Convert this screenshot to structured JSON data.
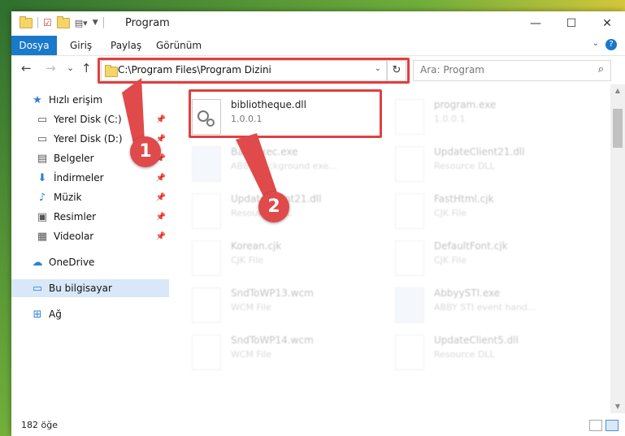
{
  "window": {
    "title": "Program",
    "minimize": "—",
    "maximize": "☐",
    "close": "✕"
  },
  "ribbon": {
    "tabs": [
      "Dosya",
      "Giriş",
      "Paylaş",
      "Görünüm"
    ]
  },
  "nav": {
    "back": "←",
    "forward": "→",
    "recent": "⌄",
    "up": "↑",
    "address": "C:\\Program Files\\Program Dizini",
    "refresh": "↻",
    "search_placeholder": "Ara: Program"
  },
  "sidebar": {
    "items": [
      {
        "label": "Hızlı erişim",
        "icon": "star-icon",
        "glyph": "★"
      },
      {
        "label": "Yerel Disk (C:)",
        "icon": "drive-icon",
        "glyph": "▭"
      },
      {
        "label": "Yerel Disk (D:)",
        "icon": "drive-icon",
        "glyph": "▭"
      },
      {
        "label": "Belgeler",
        "icon": "documents-icon",
        "glyph": "▤"
      },
      {
        "label": "İndirmeler",
        "icon": "download-icon",
        "glyph": "⬇"
      },
      {
        "label": "Müzik",
        "icon": "music-icon",
        "glyph": "♪"
      },
      {
        "label": "Resimler",
        "icon": "pictures-icon",
        "glyph": "▣"
      },
      {
        "label": "Videolar",
        "icon": "videos-icon",
        "glyph": "▦"
      },
      {
        "label": "OneDrive",
        "icon": "cloud-icon",
        "glyph": "☁"
      },
      {
        "label": "Bu bilgisayar",
        "icon": "computer-icon",
        "glyph": "▭"
      },
      {
        "label": "Ağ",
        "icon": "network-icon",
        "glyph": "⊞"
      }
    ]
  },
  "files": [
    {
      "name": "bibliotheque.dll",
      "sub": "1.0.0.1"
    },
    {
      "name": "program.exe",
      "sub": "1.0.0.1"
    },
    {
      "name": "BackExec.exe",
      "sub": "ABBY background exe..."
    },
    {
      "name": "UpdateClient21.dll",
      "sub": "Resource DLL"
    },
    {
      "name": "UpdateClient21.dll",
      "sub": "Resource DLL"
    },
    {
      "name": "FastHtml.cjk",
      "sub": "CJK File"
    },
    {
      "name": "Korean.cjk",
      "sub": "CJK File"
    },
    {
      "name": "DefaultFont.cjk",
      "sub": "CJK File"
    },
    {
      "name": "SndToWP13.wcm",
      "sub": "WCM File"
    },
    {
      "name": "AbbyySTI.exe",
      "sub": "ABBY STI event hand..."
    },
    {
      "name": "SndToWP14.wcm",
      "sub": "WCM File"
    },
    {
      "name": "UpdateClient5.dll",
      "sub": "Resource DLL"
    }
  ],
  "status": {
    "count": "182 öğe"
  },
  "annotations": {
    "badge1": "1",
    "badge2": "2",
    "highlight_color": "#e04040"
  }
}
